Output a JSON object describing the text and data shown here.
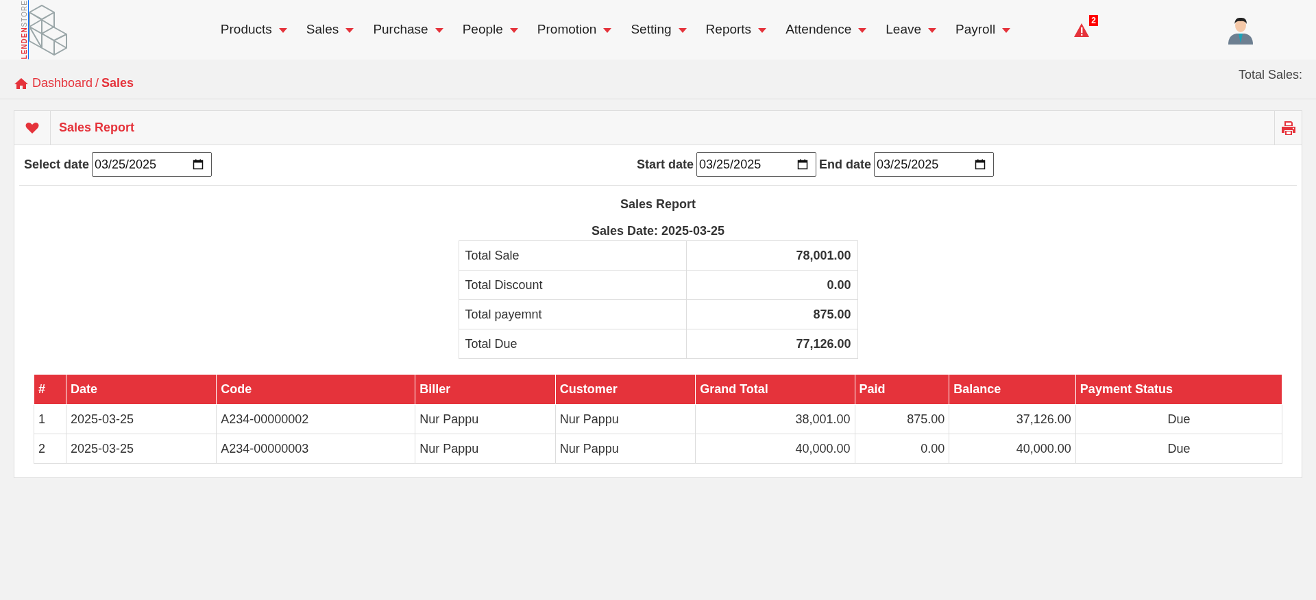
{
  "logo": {
    "brand": "LENDEN",
    "tagline": "STORE"
  },
  "nav": {
    "items": [
      {
        "label": "Products"
      },
      {
        "label": "Sales"
      },
      {
        "label": "Purchase"
      },
      {
        "label": "People"
      },
      {
        "label": "Promotion"
      },
      {
        "label": "Setting"
      },
      {
        "label": "Reports"
      },
      {
        "label": "Attendence"
      },
      {
        "label": "Leave"
      },
      {
        "label": "Payroll"
      }
    ],
    "alert_count": "2"
  },
  "breadcrumb": {
    "items": [
      {
        "label": "Dashboard",
        "current": false
      },
      {
        "label": "Sales",
        "current": true
      }
    ],
    "separator": "/"
  },
  "total_sales_label": "Total Sales:",
  "card": {
    "title": "Sales Report",
    "date_filter": {
      "label": "Select date",
      "value": "03/25/2025"
    },
    "range_filters": [
      {
        "label": "Start date",
        "value": "03/25/2025"
      },
      {
        "label": "End date",
        "value": "03/25/2025"
      }
    ],
    "report_title": "Sales Report",
    "report_subtitle": "Sales Date: 2025-03-25",
    "summary": [
      [
        "Total Sale",
        "78,001.00"
      ],
      [
        "Total Discount",
        "0.00"
      ],
      [
        "Total payemnt",
        "875.00"
      ],
      [
        "Total Due",
        "77,126.00"
      ]
    ],
    "table": {
      "columns": [
        {
          "label": "#",
          "kind": "text"
        },
        {
          "label": "Date",
          "kind": "text"
        },
        {
          "label": "Code",
          "kind": "text"
        },
        {
          "label": "Biller",
          "kind": "text"
        },
        {
          "label": "Customer",
          "kind": "text"
        },
        {
          "label": "Grand Total",
          "kind": "number"
        },
        {
          "label": "Paid",
          "kind": "number"
        },
        {
          "label": "Balance",
          "kind": "number"
        },
        {
          "label": "Payment Status",
          "kind": "status"
        }
      ],
      "rows": [
        [
          "1",
          "2025-03-25",
          "A234-00000002",
          "Nur Pappu",
          "Nur Pappu",
          "38,001.00",
          "875.00",
          "37,126.00",
          "Due"
        ],
        [
          "2",
          "2025-03-25",
          "A234-00000003",
          "Nur Pappu",
          "Nur Pappu",
          "40,000.00",
          "0.00",
          "40,000.00",
          "Due"
        ]
      ]
    }
  }
}
